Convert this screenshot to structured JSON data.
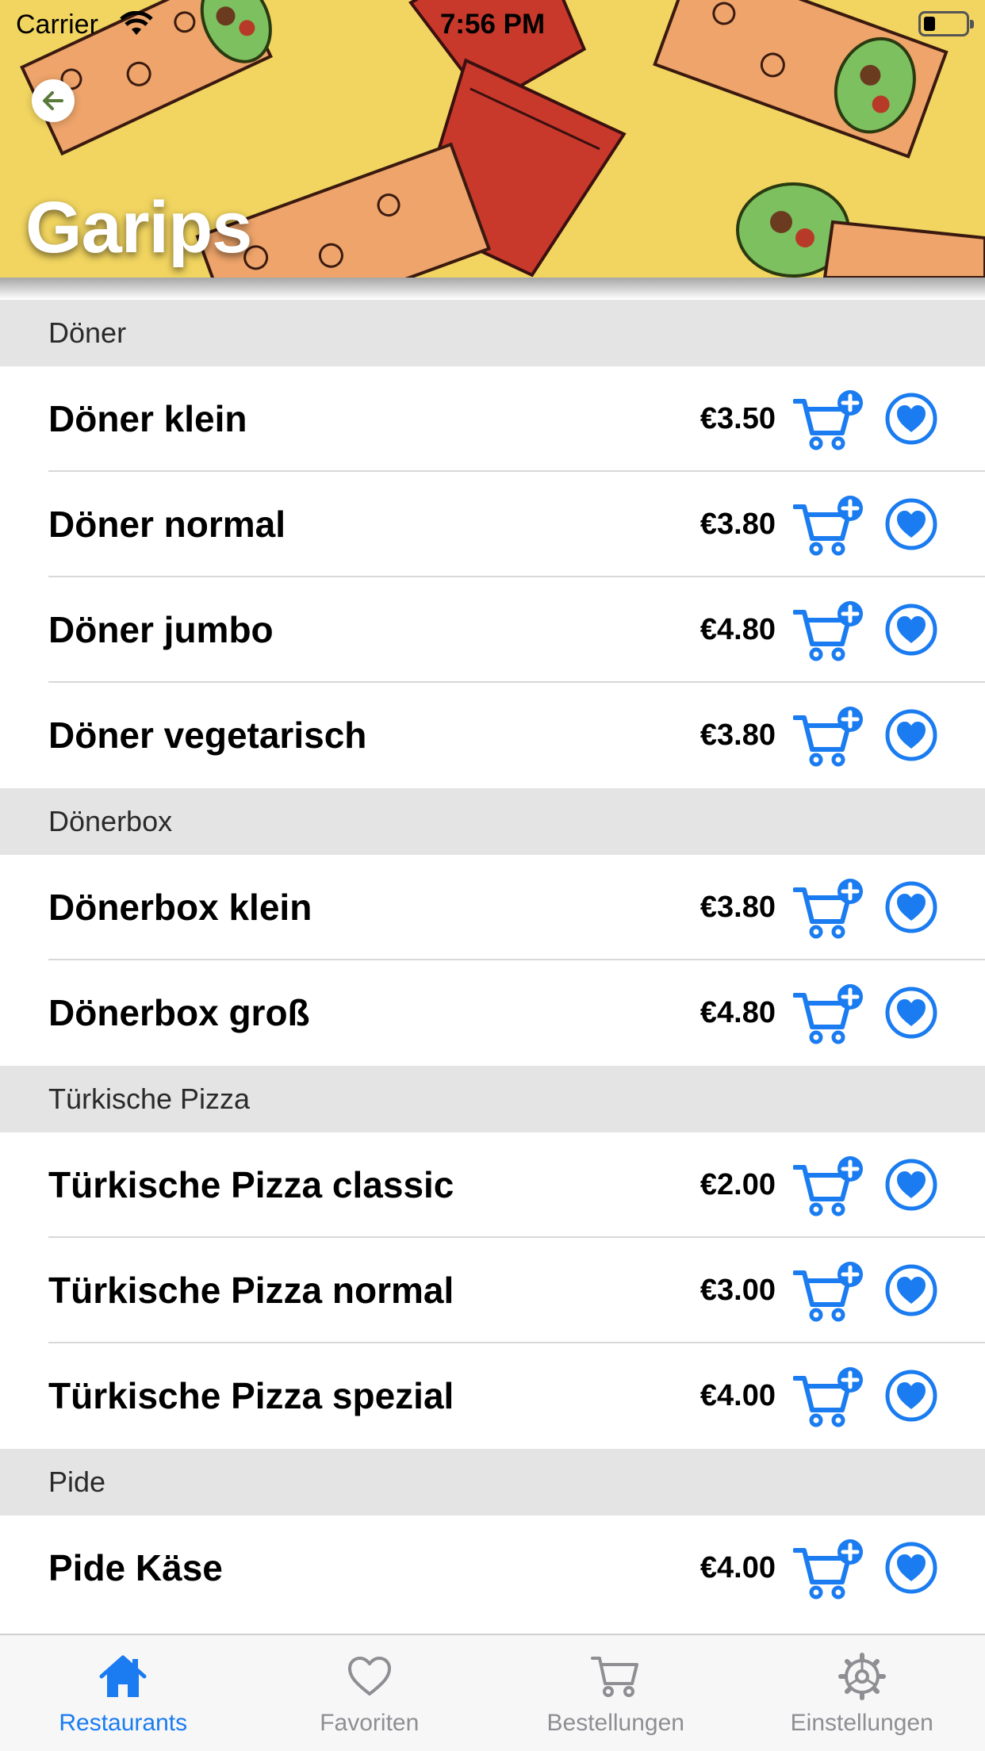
{
  "status_bar": {
    "carrier": "Carrier",
    "time": "7:56 PM"
  },
  "header": {
    "title": "Garips"
  },
  "colors": {
    "accent": "#1a7cf0",
    "inactive": "#8e8e93",
    "section_bg": "#e4e4e5",
    "header_bg": "#f2d560"
  },
  "sections": [
    {
      "title": "Döner",
      "items": [
        {
          "name": "Döner klein",
          "price": "€3.50"
        },
        {
          "name": "Döner normal",
          "price": "€3.80"
        },
        {
          "name": "Döner jumbo",
          "price": "€4.80"
        },
        {
          "name": "Döner vegetarisch",
          "price": "€3.80"
        }
      ]
    },
    {
      "title": "Dönerbox",
      "items": [
        {
          "name": "Dönerbox klein",
          "price": "€3.80"
        },
        {
          "name": "Dönerbox groß",
          "price": "€4.80"
        }
      ]
    },
    {
      "title": "Türkische Pizza",
      "items": [
        {
          "name": "Türkische Pizza classic",
          "price": "€2.00"
        },
        {
          "name": "Türkische Pizza normal",
          "price": "€3.00"
        },
        {
          "name": "Türkische Pizza spezial",
          "price": "€4.00"
        }
      ]
    },
    {
      "title": "Pide",
      "items": [
        {
          "name": "Pide Käse",
          "price": "€4.00"
        }
      ]
    }
  ],
  "tab_bar": {
    "tabs": [
      {
        "label": "Restaurants",
        "icon": "house-icon",
        "active": true
      },
      {
        "label": "Favoriten",
        "icon": "heart-icon",
        "active": false
      },
      {
        "label": "Bestellungen",
        "icon": "cart-icon",
        "active": false
      },
      {
        "label": "Einstellungen",
        "icon": "gear-icon",
        "active": false
      }
    ]
  }
}
